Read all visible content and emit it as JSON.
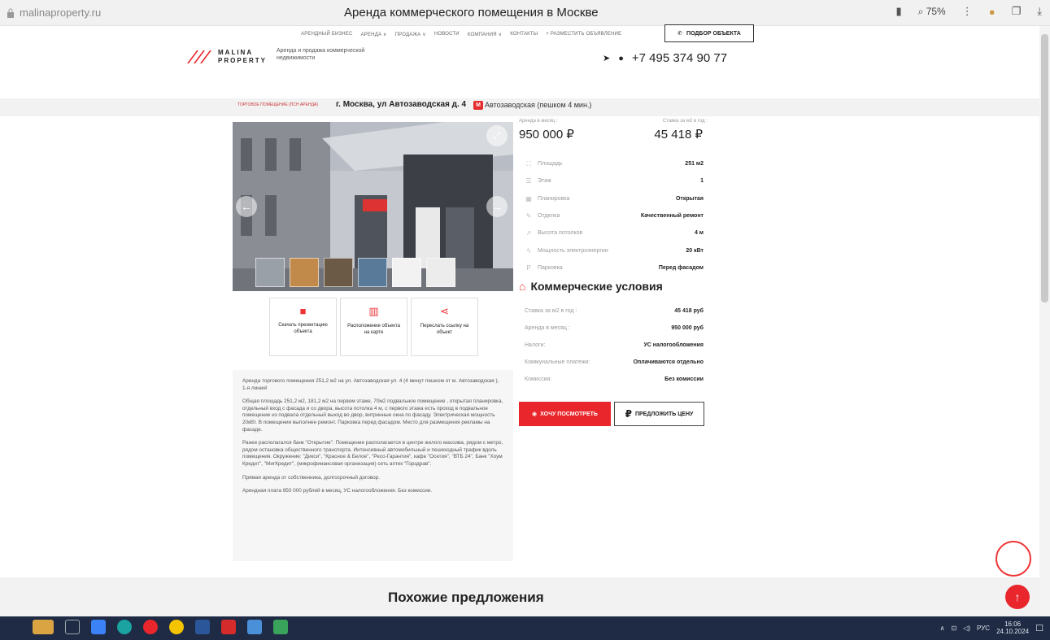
{
  "browser": {
    "url": "malinaproperty.ru",
    "tab_title": "Аренда коммерческого помещения в Москве",
    "zoom": "75%"
  },
  "header": {
    "nav_items": [
      "АРЕНДНЫЙ БИЗНЕС",
      "АРЕНДА ∨",
      "ПРОДАЖА ∨",
      "НОВОСТИ",
      "КОМПАНИЯ ∨",
      "КОНТАКТЫ",
      "+ РАЗМЕСТИТЬ ОБЪЯВЛЕНИЕ"
    ],
    "pick_button": "ПОДБОР ОБЪЕКТА",
    "logo_line1": "MALINA",
    "logo_line2": "PROPERTY",
    "tagline": "Аренда и продажа коммерческой недвижимости",
    "phone": "+7 495 374 90 77"
  },
  "address": {
    "type": "ТОРГОВОЕ ПОМЕЩЕНИЕ (ПСН АРЕНДА)",
    "street": "г. Москва, ул Автозаводская д. 4",
    "metro_badge": "М",
    "metro": "Автозаводская (пешком 4 мин.)"
  },
  "price": {
    "monthly_label": "Аренда в месяц :",
    "monthly_value": "950 000 ₽",
    "per_m2_label": "Ставка за м2 в год :",
    "per_m2_value": "45 418 ₽"
  },
  "params": [
    {
      "icon": "area-icon",
      "glyph": "⛶",
      "name": "Площадь",
      "value": "251 м2"
    },
    {
      "icon": "floor-icon",
      "glyph": "☰",
      "name": "Этаж",
      "value": "1"
    },
    {
      "icon": "layout-icon",
      "glyph": "▦",
      "name": "Планировка",
      "value": "Открытая"
    },
    {
      "icon": "finish-icon",
      "glyph": "✎",
      "name": "Отделка",
      "value": "Качественный ремонт"
    },
    {
      "icon": "ceiling-icon",
      "glyph": "↗",
      "name": "Высота потолков",
      "value": "4 м"
    },
    {
      "icon": "power-icon",
      "glyph": "ϟ",
      "name": "Мощность электроэнергии",
      "value": "20 кВт"
    },
    {
      "icon": "parking-icon",
      "glyph": "P",
      "name": "Парковка",
      "value": "Перед фасадом"
    }
  ],
  "conditions": {
    "title": "Коммерческие условия",
    "items": [
      {
        "name": "Ставка за м2 в год :",
        "value": "45 418 руб"
      },
      {
        "name": "Аренда в месяц :",
        "value": "950 000 руб"
      },
      {
        "name": "Налоги:",
        "value": "УС налогообложения"
      },
      {
        "name": "Коммунальные платежи:",
        "value": "Оплачиваются отдельно"
      },
      {
        "name": "Комиссия:",
        "value": "Без комиссии"
      }
    ]
  },
  "buttons": {
    "want_view": "ХОЧУ ПОСМОТРЕТЬ",
    "offer_price": "ПРЕДЛОЖИТЬ ЦЕНУ"
  },
  "cards": [
    {
      "icon": "download-icon",
      "glyph": "■",
      "label": "Скачать презентацию объекта"
    },
    {
      "icon": "map-icon",
      "glyph": "▥",
      "label": "Расположение объекта на карте"
    },
    {
      "icon": "share-icon",
      "glyph": "⋖",
      "label": "Переслать ссылку на объект"
    }
  ],
  "description": [
    "Аренда торгового помещения 251,2 м2 на ул. Автозаводская ул. 4 (4 минут пешком от м. Автозаводская ), 1-я линия!",
    "Общая площадь 251,2 м2, 181,2 м2 на первом этаже, 70м2 подвальное помещение , открытая планировка, отдельный вход с фасада и со двора, высота потолка 4 м, с первого этажа есть проход в подвальное помещение из подвала отдельный выход во двор, витринные окна по фасаду. Электрическая мощность 20кВт. В помещении выполнен ремонт. Парковка перед фасадом. Место для размещения рекламы на фасаде.",
    "Ранее располагался банк \"Открытие\". Помещение располагается в центре жилого массива, рядом с метро, рядом остановка общественного транспорта. Интенсивный автомобильный и пешеходный трафик вдоль помещения. Окружение: \"Дикси\", \"Красное & Белое\", \"Ресо-Гарантия\", кафе \"Осетия\", \"ВТБ 24\", Банк \"Хоум Кредит\", \"МигКредит\", (микрофинансовая организация) сеть аптек \"Горздрав\".",
    "Прямая аренда от собственника, долгосрочный договор.",
    "Арендная плата 950 000 рублей в месяц, УС налогообложения. Без комиссии."
  ],
  "similar": {
    "title": "Похожие предложения"
  },
  "taskbar": {
    "lang": "РУС",
    "time": "16:06",
    "date": "24.10.2024"
  },
  "colors": {
    "accent": "#e8262b",
    "taskbar": "#1f2a44"
  }
}
